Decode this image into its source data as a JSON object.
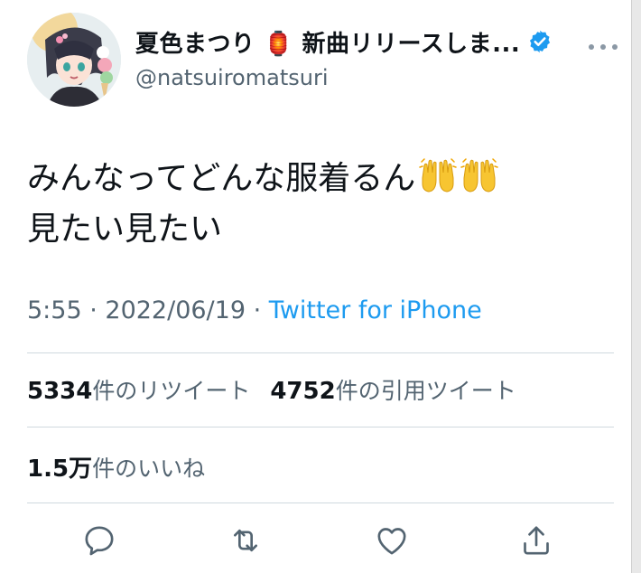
{
  "tweet": {
    "author": {
      "display_name": "夏色まつり 🏮 新曲リリースしま...",
      "handle": "@natsuiromatsuri",
      "verified": true
    },
    "text_lines": [
      "みんなってどんな服着るん",
      "見たい見たい"
    ],
    "text_emoji": [
      "raising-hands",
      "raising-hands"
    ],
    "meta": {
      "time": "5:55",
      "separator": " · ",
      "date": "2022/06/19",
      "source": "Twitter for iPhone"
    },
    "stats": {
      "retweets": {
        "count": "5334",
        "label": "件のリツイート"
      },
      "quotes": {
        "count": "4752",
        "label": "件の引用ツイート"
      },
      "likes": {
        "count": "1.5万",
        "label": "件のいいね"
      }
    },
    "actions": [
      "reply-icon",
      "retweet-icon",
      "like-icon",
      "share-icon"
    ]
  },
  "colors": {
    "text": "#0f1419",
    "muted": "#536471",
    "accent": "#1d9bf0",
    "divider": "#cfd9de",
    "verified": "#1d9bf0"
  }
}
